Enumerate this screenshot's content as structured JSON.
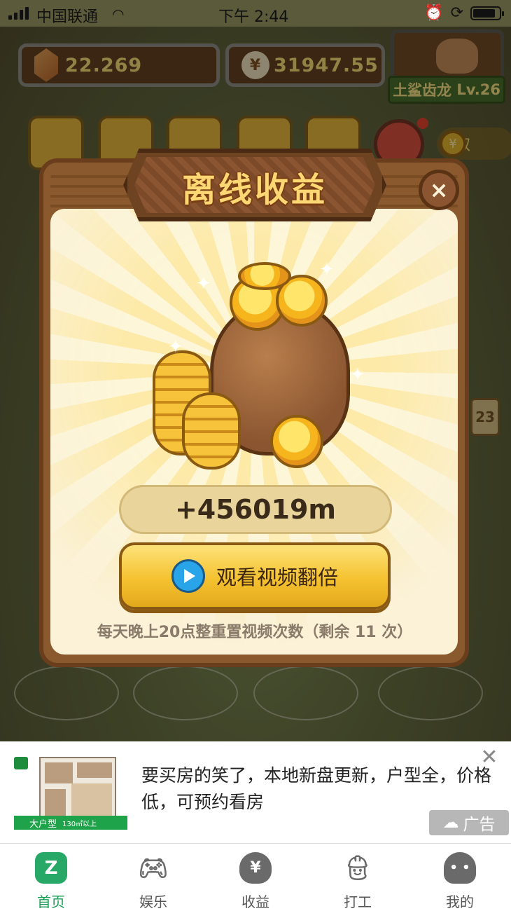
{
  "status_bar": {
    "carrier": "中国联通",
    "time": "下午 2:44",
    "battery_level": 0.85
  },
  "hud": {
    "gems": "22.269",
    "money": "31947.55",
    "money_symbol": "¥",
    "dino_name": "土鲨齿龙",
    "dino_level": "Lv.26",
    "claim_label": "领取",
    "claim_symbol": "¥",
    "side_number": "23"
  },
  "modal": {
    "title": "离线收益",
    "close_symbol": "×",
    "amount": "+456019m",
    "watch_button": "观看视频翻倍",
    "reset_note": "每天晚上20点整重置视频次数（剩余 11 次）"
  },
  "ad": {
    "text": "要买房的笑了，本地新盘更新，户型全，价格低，可预约看房",
    "thumb_caption": "大户型",
    "thumb_sub": "130㎡以上",
    "badge": "广告",
    "close_symbol": "✕"
  },
  "tabs": [
    {
      "label": "首页",
      "icon": "home-logo-icon",
      "active": true
    },
    {
      "label": "娱乐",
      "icon": "gamepad-icon",
      "active": false
    },
    {
      "label": "收益",
      "icon": "money-bag-icon",
      "active": false
    },
    {
      "label": "打工",
      "icon": "worker-icon",
      "active": false
    },
    {
      "label": "我的",
      "icon": "ghost-profile-icon",
      "active": false
    }
  ],
  "colors": {
    "accent_green": "#1a9e56",
    "coin_gold": "#f5c230",
    "wood_brown": "#8a5a2e"
  }
}
